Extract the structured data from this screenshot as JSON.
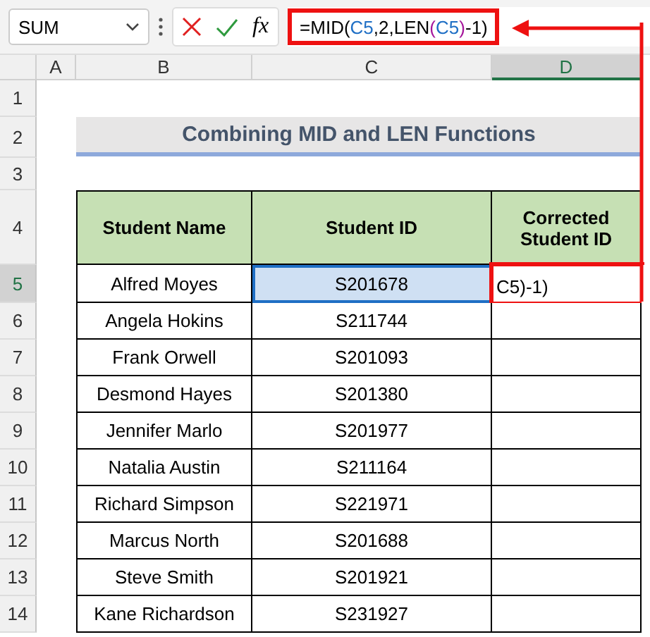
{
  "formula_bar": {
    "name_box": "SUM",
    "function_label": "fx",
    "highlighted": true,
    "formula": [
      {
        "text": "=MID(",
        "color": "#000000"
      },
      {
        "text": "C5",
        "color": "#1f6fc5"
      },
      {
        "text": ",2,LEN",
        "color": "#000000"
      },
      {
        "text": "(",
        "color": "#a5159b"
      },
      {
        "text": "C5",
        "color": "#1f6fc5"
      },
      {
        "text": ")",
        "color": "#a5159b"
      },
      {
        "text": "-1)",
        "color": "#000000"
      }
    ]
  },
  "columns": [
    {
      "label": "A",
      "selected": false
    },
    {
      "label": "B",
      "selected": false
    },
    {
      "label": "C",
      "selected": false
    },
    {
      "label": "D",
      "selected": true
    }
  ],
  "title": "Combining MID and LEN Functions",
  "table": {
    "columns": [
      "Student Name",
      "Student ID",
      "Corrected Student ID"
    ],
    "rows": [
      {
        "row": "5",
        "selected": true,
        "name": "Alfred Moyes",
        "id": "S201678",
        "id_selected": true,
        "corrected": "C5)-1)",
        "corrected_highlighted": true
      },
      {
        "row": "6",
        "selected": false,
        "name": "Angela Hokins",
        "id": "S211744",
        "id_selected": false
      },
      {
        "row": "7",
        "selected": false,
        "name": "Frank Orwell",
        "id": "S201093",
        "id_selected": false
      },
      {
        "row": "8",
        "selected": false,
        "name": "Desmond Hayes",
        "id": "S201380",
        "id_selected": false
      },
      {
        "row": "9",
        "selected": false,
        "name": "Jennifer Marlo",
        "id": "S201977",
        "id_selected": false
      },
      {
        "row": "10",
        "selected": false,
        "name": "Natalia Austin",
        "id": "S211164",
        "id_selected": false
      },
      {
        "row": "11",
        "selected": false,
        "name": "Richard Simpson",
        "id": "S221971",
        "id_selected": false
      },
      {
        "row": "12",
        "selected": false,
        "name": "Marcus North",
        "id": "S201688",
        "id_selected": false
      },
      {
        "row": "13",
        "selected": false,
        "name": "Steve Smith",
        "id": "S201921",
        "id_selected": false
      },
      {
        "row": "14",
        "selected": false,
        "name": "Kane Richardson",
        "id": "S231927",
        "id_selected": false
      }
    ]
  },
  "row_headers": [
    "1",
    "2",
    "3",
    "4"
  ]
}
